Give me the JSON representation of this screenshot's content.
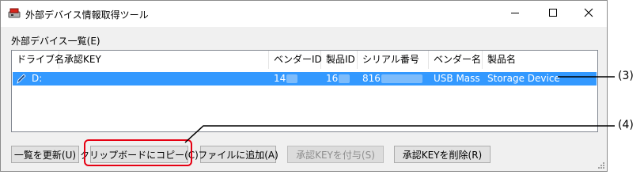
{
  "window": {
    "title": "外部デバイス情報取得ツール"
  },
  "device_list": {
    "label": "外部デバイス一覧(E)",
    "columns": [
      "ドライブ名",
      "承認KEY",
      "ベンダーID",
      "製品ID",
      "シリアル番号",
      "ベンダー名",
      "製品名"
    ],
    "rows": [
      {
        "drive": "D:",
        "approval_key": "",
        "vendor_id": "14",
        "product_id": "16",
        "serial": "816",
        "vendor_name": "USB Mass",
        "product_name": "Storage Device"
      }
    ]
  },
  "buttons": {
    "refresh": "一覧を更新(U)",
    "copy": "クリップボードにコピー(C)",
    "add_file": "ファイルに追加(A)",
    "grant_key": "承認KEYを付与(S)",
    "delete_key": "承認KEYを削除(R)"
  },
  "callouts": {
    "c3": "(3)",
    "c4": "(4)"
  },
  "colors": {
    "selection": "#3399ff",
    "highlight": "#e60012"
  },
  "icons": {
    "app": "usb-drive-icon",
    "row": "pencil-icon"
  }
}
